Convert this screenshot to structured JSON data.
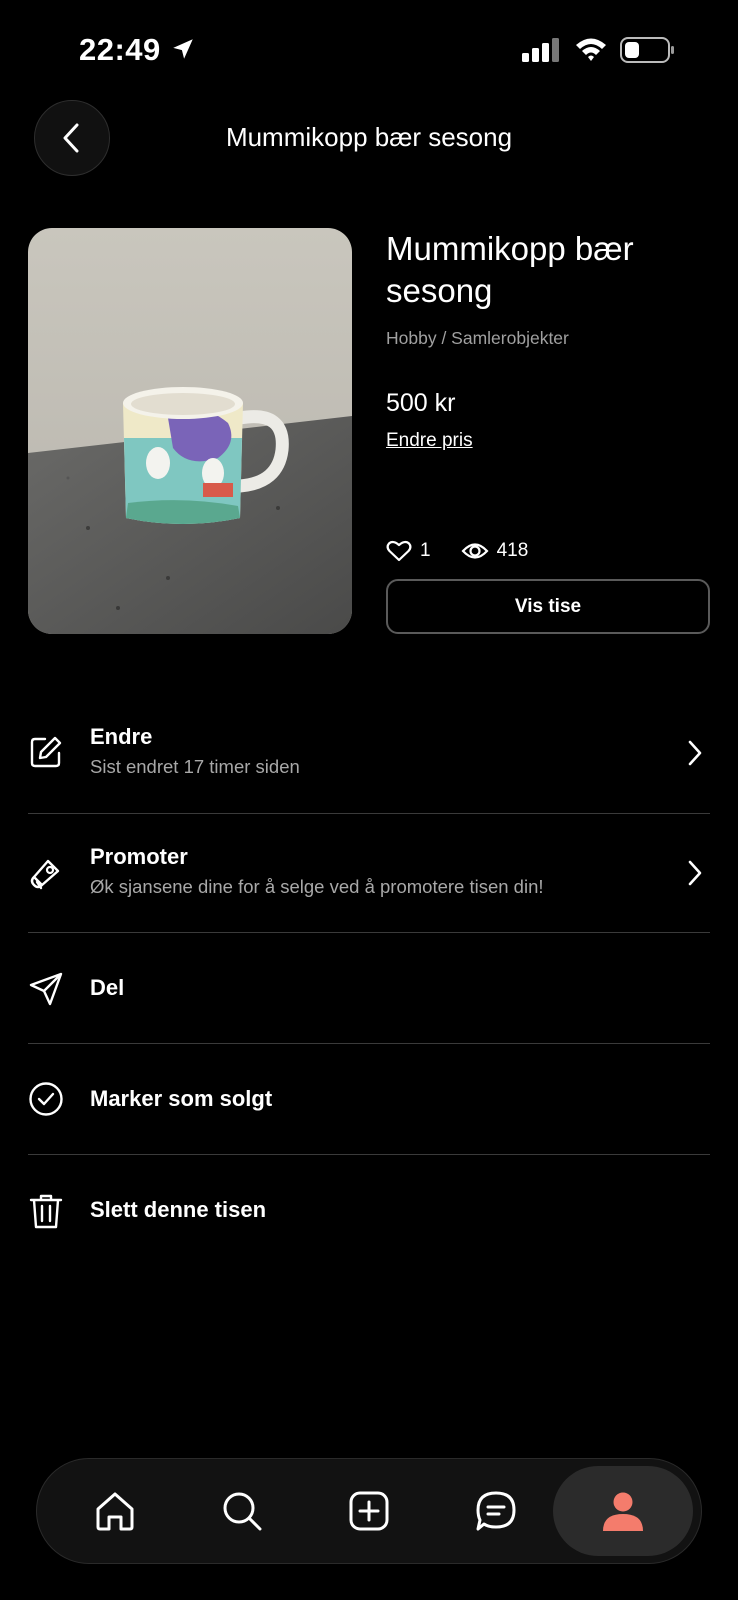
{
  "status_bar": {
    "time": "22:49"
  },
  "header": {
    "title": "Mummikopp bær sesong"
  },
  "product": {
    "title": "Mummikopp bær sesong",
    "category": "Hobby / Samlerobjekter",
    "price": "500 kr",
    "edit_price": "Endre pris",
    "likes": "1",
    "views": "418",
    "view_button": "Vis tise"
  },
  "menu": {
    "edit": {
      "title": "Endre",
      "subtitle": "Sist endret 17 timer siden"
    },
    "promote": {
      "title": "Promoter",
      "subtitle": "Øk sjansene dine for å selge ved å promotere tisen din!"
    },
    "share": {
      "title": "Del"
    },
    "mark_sold": {
      "title": "Marker som solgt"
    },
    "delete": {
      "title": "Slett denne tisen"
    }
  },
  "tabbar": {
    "items": [
      "home-icon",
      "search-icon",
      "add-icon",
      "messages-icon",
      "profile-icon"
    ],
    "active": "profile-icon",
    "accent_color": "#f47c6c"
  }
}
